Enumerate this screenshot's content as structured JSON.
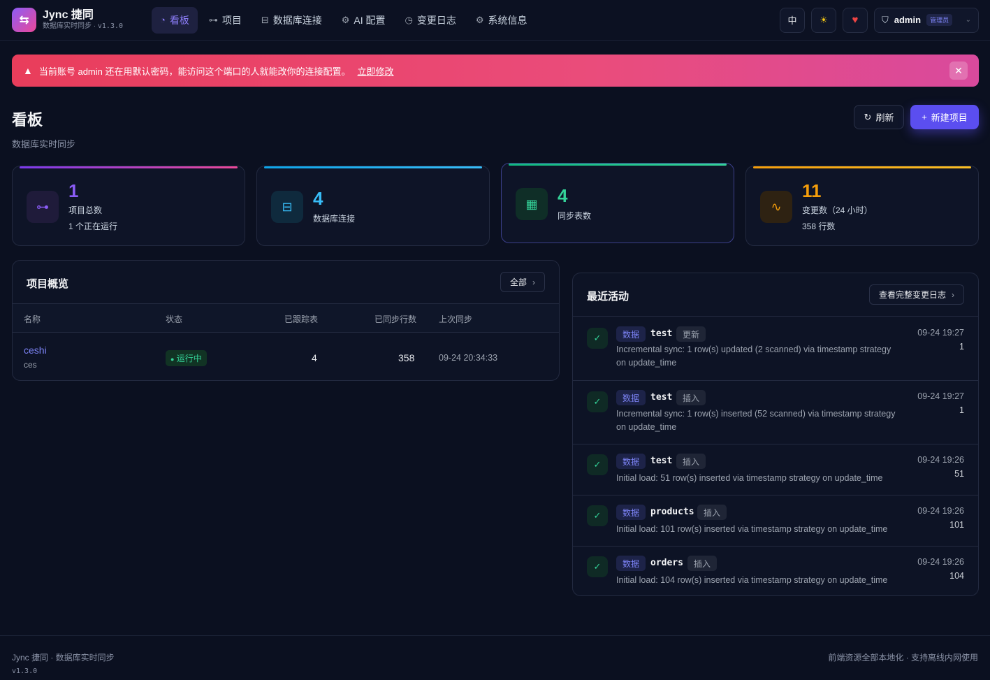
{
  "brand": {
    "name": "Jync 捷同",
    "subtitle": "数据库实时同步",
    "version": "v1.3.0"
  },
  "nav": [
    {
      "label": "看板",
      "icon": "dashboard-icon",
      "active": true
    },
    {
      "label": "项目",
      "icon": "project-tree-icon"
    },
    {
      "label": "数据库连接",
      "icon": "database-connection-icon"
    },
    {
      "label": "AI 配置",
      "icon": "ai-chip-icon"
    },
    {
      "label": "变更日志",
      "icon": "clock-history-icon"
    },
    {
      "label": "系统信息",
      "icon": "gear-icon"
    }
  ],
  "header": {
    "lang_label": "中",
    "user": "admin",
    "role": "管理员"
  },
  "alert": {
    "message": "当前账号 admin 还在用默认密码，能访问这个端口的人就能改你的连接配置。",
    "link": "立即修改"
  },
  "page": {
    "title": "看板",
    "subtitle": "数据库实时同步",
    "refresh_label": "刷新",
    "new_label": "新建项目"
  },
  "stats": [
    {
      "value": "1",
      "label": "项目总数",
      "extra": "1 个正在运行",
      "color": "#8b5cf6"
    },
    {
      "value": "4",
      "label": "数据库连接",
      "extra": "",
      "color": "#38bdf8"
    },
    {
      "value": "4",
      "label": "同步表数",
      "extra": "",
      "color": "#34d399"
    },
    {
      "value": "11",
      "label": "变更数（24 小时）",
      "extra": "358 行数",
      "color": "#f59e0b"
    }
  ],
  "projects": {
    "title": "项目概览",
    "all_label": "全部",
    "columns": [
      "名称",
      "状态",
      "已跟踪表",
      "已同步行数",
      "上次同步"
    ],
    "rows": [
      {
        "name": "ceshi",
        "desc": "ces",
        "status": "运行中",
        "tables": "4",
        "rows": "358",
        "last_sync": "09-24 20:34:33"
      }
    ]
  },
  "activity": {
    "title": "最近活动",
    "link_label": "查看完整变更日志",
    "items": [
      {
        "tag": "数据",
        "table": "test",
        "op": "更新",
        "desc": "Incremental sync: 1 row(s) updated (2 scanned) via timestamp strategy on update_time",
        "time": "09-24 19:27",
        "count": "1"
      },
      {
        "tag": "数据",
        "table": "test",
        "op": "插入",
        "desc": "Incremental sync: 1 row(s) inserted (52 scanned) via timestamp strategy on update_time",
        "time": "09-24 19:27",
        "count": "1"
      },
      {
        "tag": "数据",
        "table": "test",
        "op": "插入",
        "desc": "Initial load: 51 row(s) inserted via timestamp strategy on update_time",
        "time": "09-24 19:26",
        "count": "51"
      },
      {
        "tag": "数据",
        "table": "products",
        "op": "插入",
        "desc": "Initial load: 101 row(s) inserted via timestamp strategy on update_time",
        "time": "09-24 19:26",
        "count": "101"
      },
      {
        "tag": "数据",
        "table": "orders",
        "op": "插入",
        "desc": "Initial load: 104 row(s) inserted via timestamp strategy on update_time",
        "time": "09-24 19:26",
        "count": "104"
      }
    ]
  },
  "footer": {
    "left": "Jync 捷同 · 数据库实时同步",
    "version": "v1.3.0",
    "right": "前端资源全部本地化 · 支持离线内网使用"
  }
}
